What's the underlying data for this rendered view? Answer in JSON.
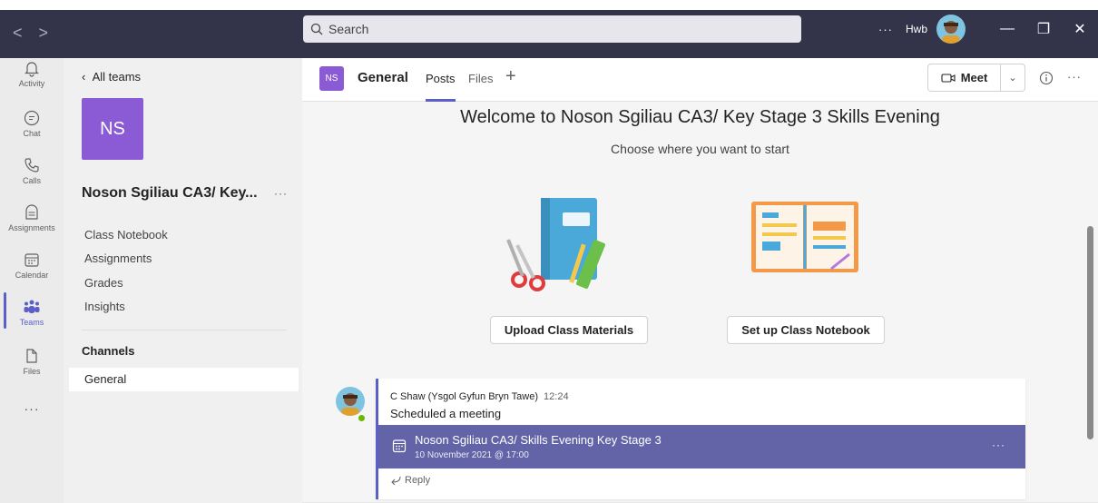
{
  "titlebar": {
    "back_label": "<",
    "forward_label": ">",
    "search_placeholder": "Search",
    "more_label": "···",
    "org_label": "Hwb",
    "minimize_label": "—",
    "maximize_label": "❐",
    "close_label": "✕"
  },
  "rail": {
    "items": [
      {
        "label": "Activity",
        "icon": "bell-icon"
      },
      {
        "label": "Chat",
        "icon": "chat-icon"
      },
      {
        "label": "Calls",
        "icon": "phone-icon"
      },
      {
        "label": "Assignments",
        "icon": "assignments-icon"
      },
      {
        "label": "Calendar",
        "icon": "calendar-icon"
      },
      {
        "label": "Teams",
        "icon": "teams-icon"
      },
      {
        "label": "Files",
        "icon": "file-icon"
      }
    ],
    "more_label": "···",
    "active": "Teams"
  },
  "team_panel": {
    "back_label": "All teams",
    "tile_initials": "NS",
    "team_name": "Noson Sgiliau CA3/ Key...",
    "more_label": "···",
    "links": [
      "Class Notebook",
      "Assignments",
      "Grades",
      "Insights"
    ],
    "channels_heading": "Channels",
    "channels": [
      "General"
    ]
  },
  "main": {
    "badge_initials": "NS",
    "channel_title": "General",
    "tabs": [
      "Posts",
      "Files"
    ],
    "add_tab_label": "+",
    "meet_label": "Meet",
    "more_label": "···",
    "welcome_title": "Welcome to Noson Sgiliau CA3/ Key Stage 3 Skills Evening",
    "welcome_subtitle": "Choose where you want to start",
    "upload_button": "Upload Class Materials",
    "notebook_button": "Set up Class Notebook"
  },
  "post": {
    "author": "C Shaw (Ysgol Gyfun Bryn Tawe)",
    "time": "12:24",
    "text": "Scheduled a meeting",
    "meeting_title": "Noson Sgiliau CA3/ Skills Evening Key Stage 3",
    "meeting_date": "10 November 2021 @ 17:00",
    "meeting_more": "···",
    "reply_label": "Reply"
  },
  "colors": {
    "titlebar": "#33344a",
    "accent": "#5b5fc7",
    "team_tile": "#8b5bd6",
    "meeting_bar": "#6264a7",
    "presence": "#6bb700"
  }
}
